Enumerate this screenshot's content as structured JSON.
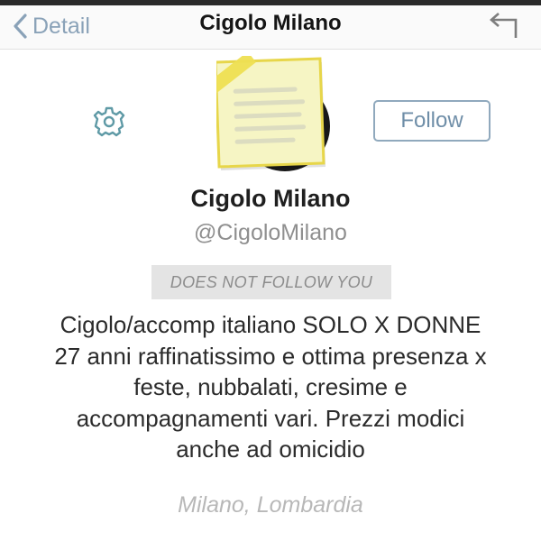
{
  "nav": {
    "back_label": "Detail",
    "title": "Cigolo Milano"
  },
  "profile": {
    "follow_label": "Follow",
    "display_name": "Cigolo Milano",
    "handle": "@CigoloMilano",
    "follow_status": "DOES NOT FOLLOW YOU",
    "bio_lines": [
      "Cigolo/accomp italiano SOLO X DONNE",
      "27 anni raffinatissimo e ottima presenza x",
      "feste, nubbalati, cresime e",
      "accompagnamenti vari. Prezzi modici",
      "anche ad omicidio"
    ],
    "location": "Milano, Lombardia"
  },
  "icons": {
    "back": "chevron-left-icon",
    "reply": "reply-arrow-icon",
    "settings": "gear-icon",
    "avatar_overlay": "sticky-note-icon"
  },
  "colors": {
    "accent": "#8aa2b8",
    "follow_border": "#90a9bd",
    "sticky_note": "#f6f5c4",
    "tape": "#eedf52"
  }
}
